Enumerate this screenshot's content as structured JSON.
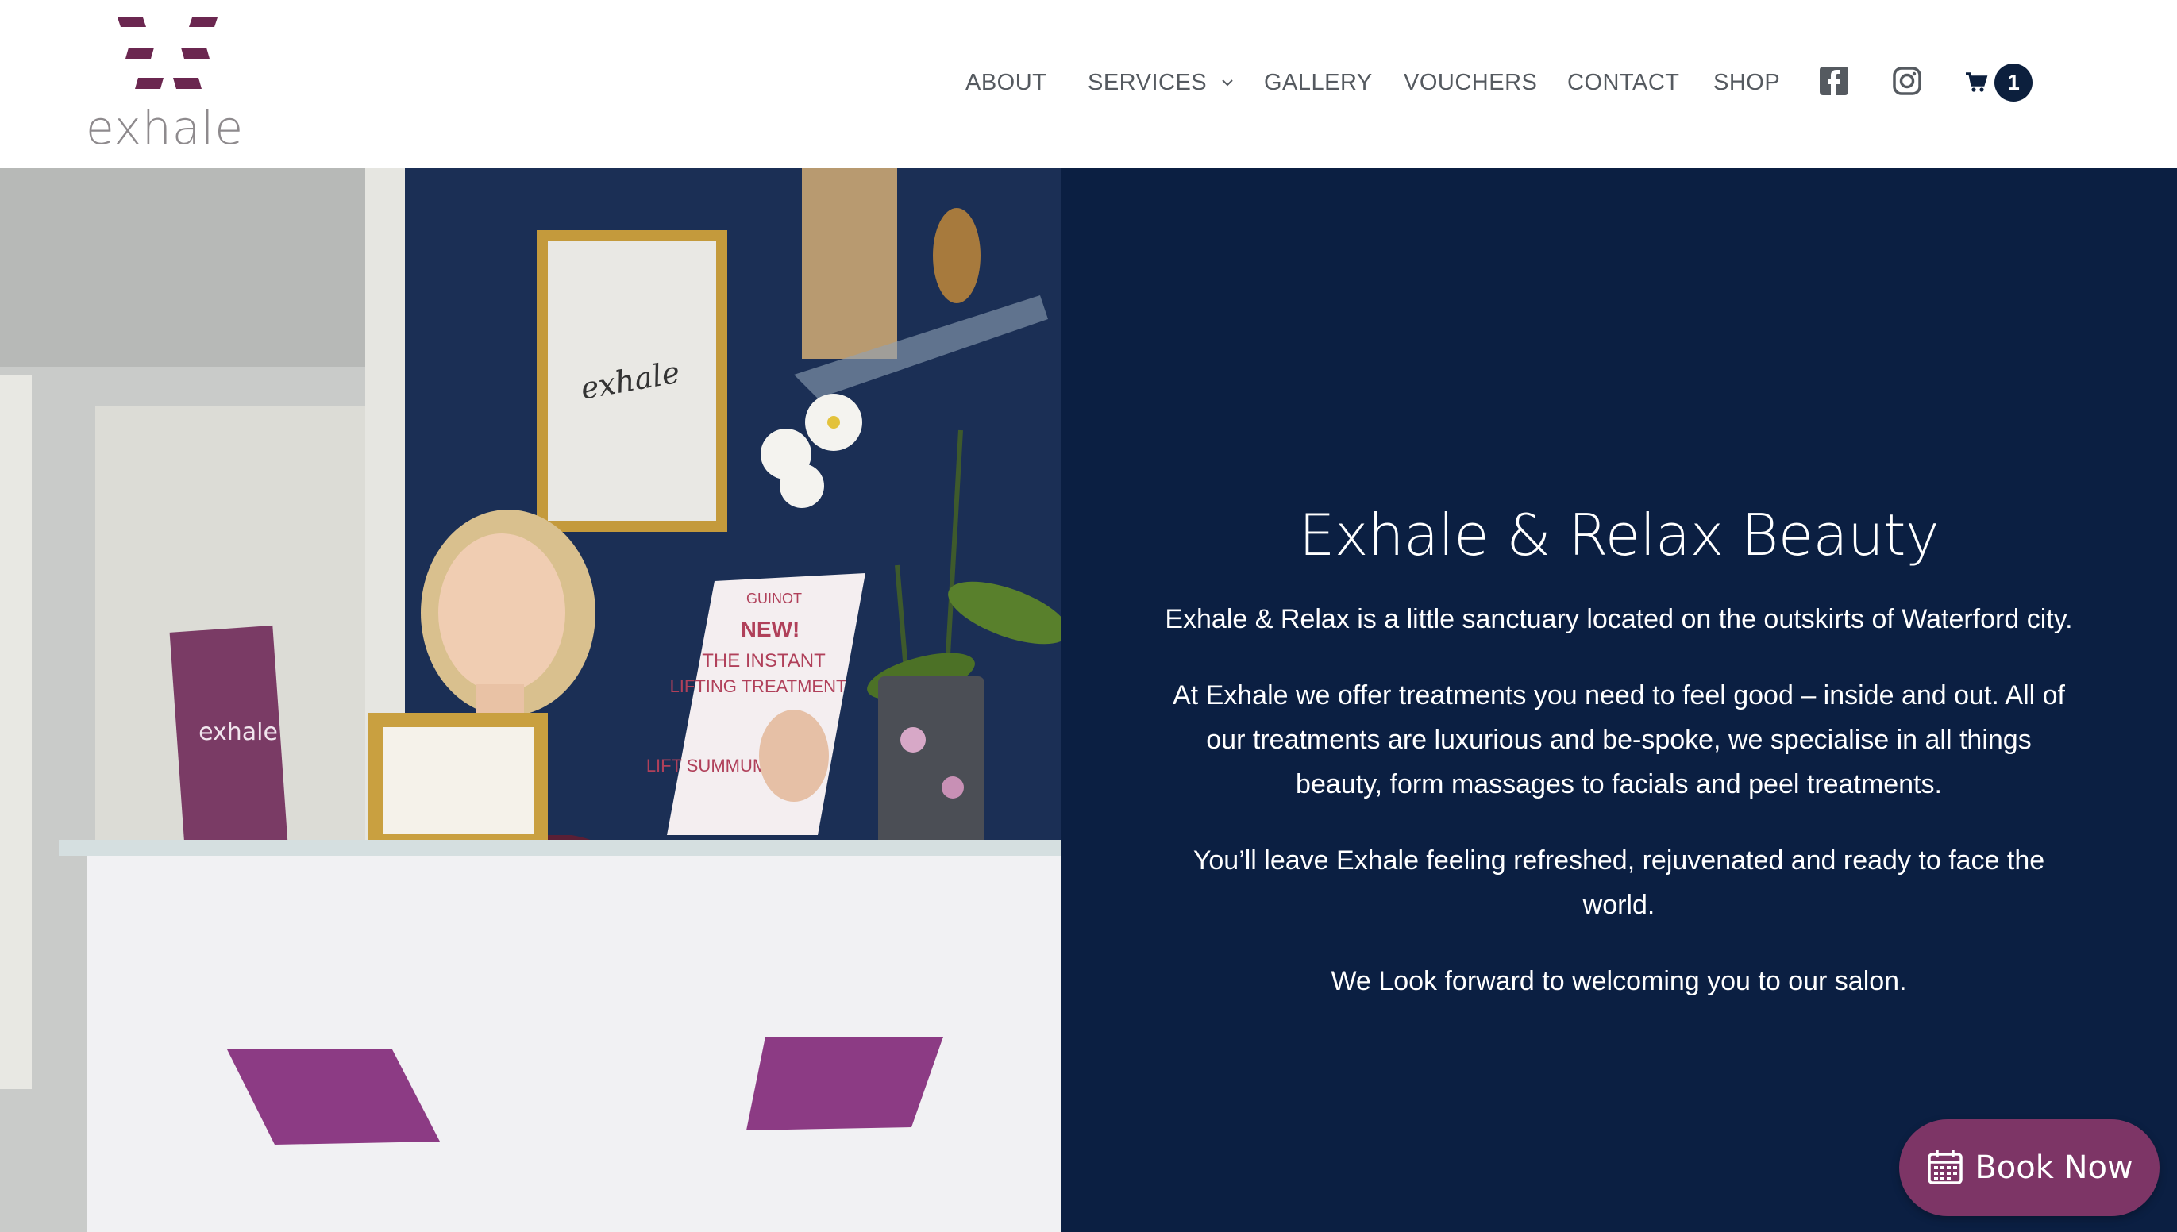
{
  "brand": {
    "logo_text": "exhale",
    "accent": "#6b2750"
  },
  "nav": {
    "items": [
      {
        "label": "ABOUT"
      },
      {
        "label": "SERVICES",
        "has_dropdown": true
      },
      {
        "label": "GALLERY"
      },
      {
        "label": "VOUCHERS"
      },
      {
        "label": "CONTACT"
      },
      {
        "label": "SHOP"
      }
    ],
    "social": [
      {
        "icon": "facebook-icon"
      },
      {
        "icon": "instagram-icon"
      }
    ],
    "cart": {
      "icon": "cart-icon",
      "count": "1"
    }
  },
  "hero": {
    "photo": {
      "description_icon": "salon-reception-photo",
      "frame_script": "exhale",
      "display_sign": {
        "brand": "GUINOT",
        "headline": "NEW!",
        "line1": "THE INSTANT",
        "line2": "LIFTING TREATMENT",
        "product": "LIFT SUMMUM"
      },
      "brochure_text": "exhale"
    },
    "panel": {
      "title": "Exhale & Relax Beauty",
      "paragraphs": [
        "Exhale & Relax is a little sanctuary located on the outskirts of Waterford city.",
        "At Exhale we offer treatments you need to feel good – inside and out. All of our treatments are luxurious and be-spoke, we specialise in all things beauty, form massages to facials and peel treatments.",
        "You’ll leave Exhale feeling refreshed, rejuvenated and ready to face the world.",
        "We Look forward to welcoming you to our salon."
      ],
      "background": "#0b1f42"
    }
  },
  "book_now": {
    "label": "Book Now",
    "icon": "calendar-icon",
    "color": "#7d3566"
  }
}
